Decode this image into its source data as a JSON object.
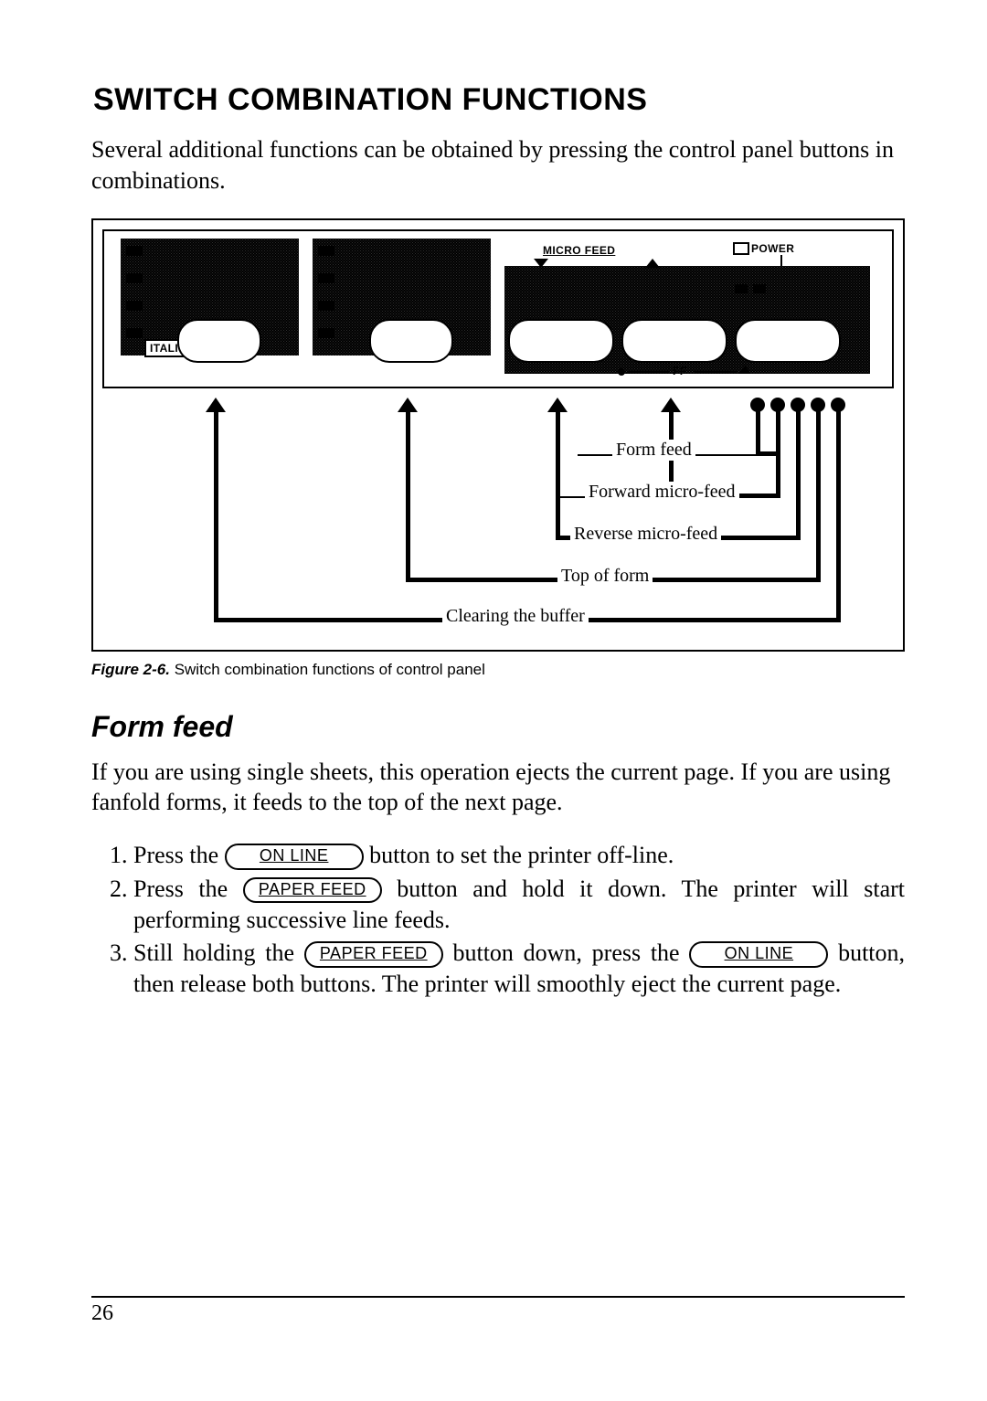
{
  "heading": "SWITCH COMBINATION FUNCTIONS",
  "intro": "Several additional functions can be obtained by pressing the control panel buttons in combinations.",
  "panel": {
    "micro_feed_label": "MICRO FEED",
    "power_label": "POWER",
    "italic_label": "ITALIC",
    "ff_label": "FF"
  },
  "bracket_labels": {
    "form_feed": "Form feed",
    "forward_micro_feed": "Forward micro-feed",
    "reverse_micro_feed": "Reverse micro-feed",
    "top_of_form": "Top of form",
    "clearing_buffer": "Clearing the buffer"
  },
  "caption": {
    "fignum": "Figure 2-6.",
    "text": " Switch combination functions of control panel"
  },
  "subheading": "Form feed",
  "sub_intro": "If you are using single sheets, this operation ejects the current page. If you are using fanfold forms, it feeds to the top of the next page.",
  "buttons": {
    "on_line": "ON LINE",
    "paper_feed": "PAPER FEED"
  },
  "steps": {
    "s1a": "Press the ",
    "s1b": " button to set the printer off-line.",
    "s2a": "Press the ",
    "s2b": " button and hold it down. The printer will start performing successive line feeds.",
    "s3a": "Still holding the ",
    "s3b": " button down, press the ",
    "s3c": " button, then release both buttons. The printer will smoothly eject the current page."
  },
  "page_number": "26"
}
